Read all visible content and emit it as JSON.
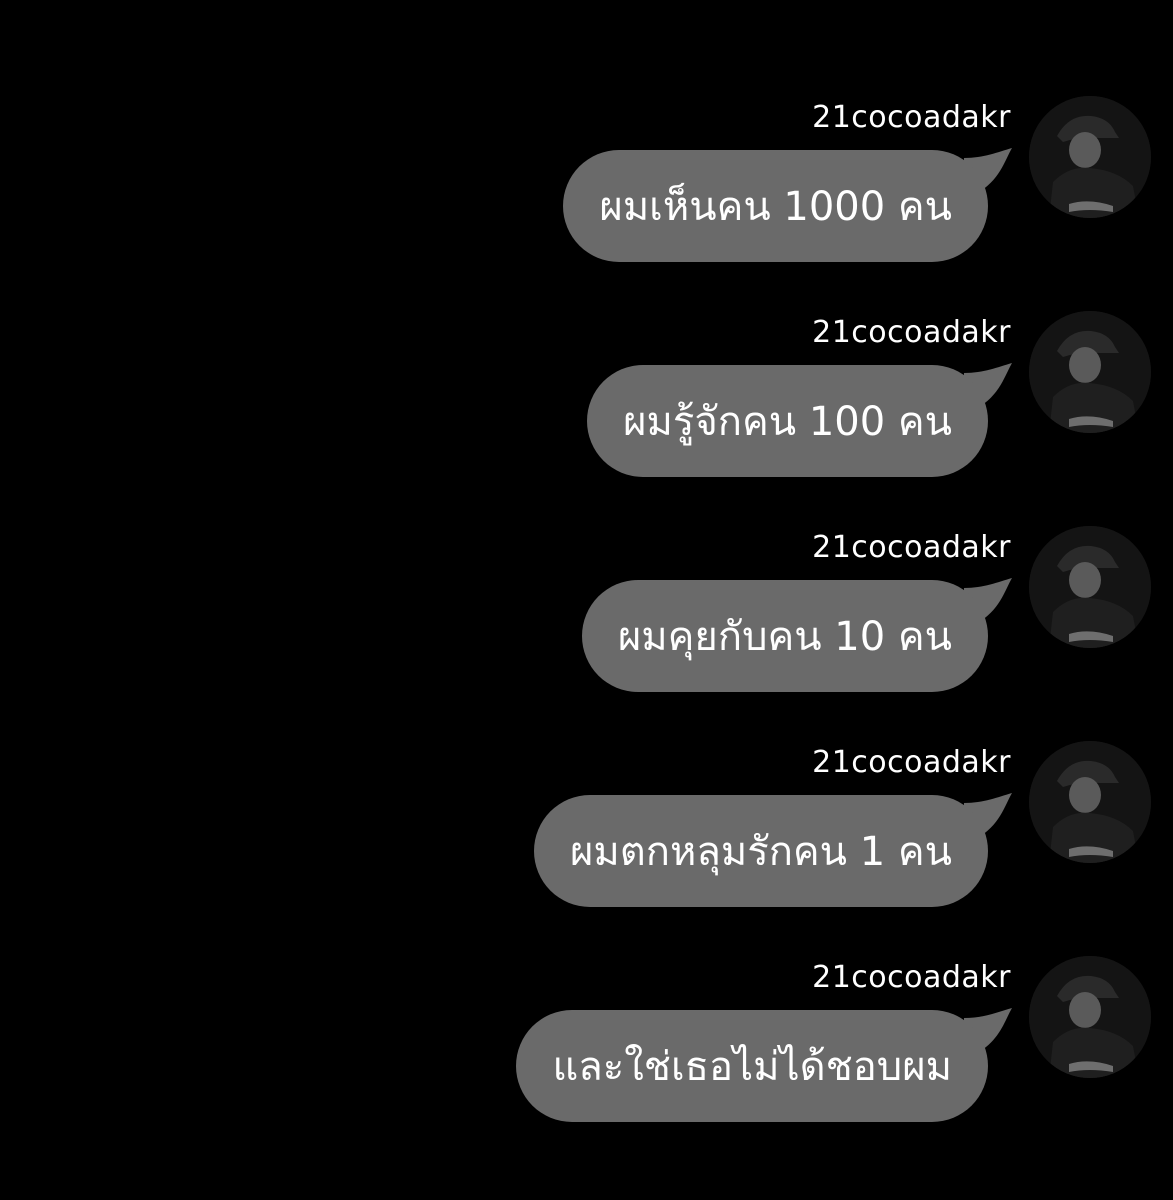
{
  "colors": {
    "background": "#000000",
    "bubble": "#6a6a6a",
    "text": "#ffffff"
  },
  "messages": [
    {
      "sender": "21cocoadakr",
      "text": "ผมเห็นคน 1000 คน",
      "avatar_icon": "user-avatar-icon"
    },
    {
      "sender": "21cocoadakr",
      "text": "ผมรู้จักคน 100 คน",
      "avatar_icon": "user-avatar-icon"
    },
    {
      "sender": "21cocoadakr",
      "text": "ผมคุยกับคน 10 คน",
      "avatar_icon": "user-avatar-icon"
    },
    {
      "sender": "21cocoadakr",
      "text": "ผมตกหลุมรักคน 1 คน",
      "avatar_icon": "user-avatar-icon"
    },
    {
      "sender": "21cocoadakr",
      "text": "และใช่เธอไม่ได้ชอบผม",
      "avatar_icon": "user-avatar-icon"
    }
  ]
}
